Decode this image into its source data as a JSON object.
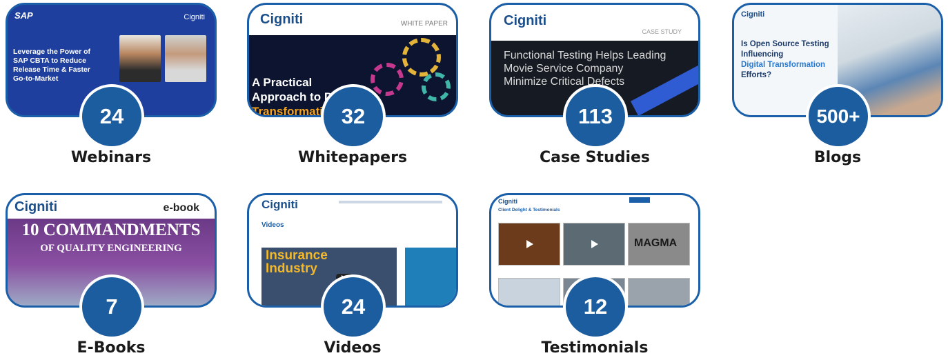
{
  "colors": {
    "accent": "#1c5d9f",
    "border": "#1b5fa8"
  },
  "cards": [
    {
      "key": "webinars",
      "count": "24",
      "label": "Webinars",
      "thumb": {
        "brand": "SAP",
        "logo": "Cigniti",
        "headline": [
          "Leverage the Power of",
          "SAP CBTA to Reduce",
          "Release Time & Faster",
          "Go-to-Market"
        ]
      }
    },
    {
      "key": "whitepapers",
      "count": "32",
      "label": "Whitepapers",
      "thumb": {
        "logo": "Cigniti",
        "tag": "WHITE PAPER",
        "headline": [
          "A Practical",
          "Approach to D",
          "Transformati"
        ]
      }
    },
    {
      "key": "case-studies",
      "count": "113",
      "label": "Case Studies",
      "thumb": {
        "logo": "Cigniti",
        "tag": "CASE STUDY",
        "headline": [
          "Functional Testing Helps Leading",
          "Movie Service Company",
          "Minimize Critical Defects"
        ]
      }
    },
    {
      "key": "blogs",
      "count": "500+",
      "label": "Blogs",
      "thumb": {
        "logo": "Cigniti",
        "headline": [
          "Is Open Source Testing",
          "Influencing",
          "Digital Transformation",
          "Efforts?"
        ]
      }
    },
    {
      "key": "ebooks",
      "count": "7",
      "label": "E-Books",
      "thumb": {
        "logo": "Cigniti",
        "tag": "e-book",
        "headline": [
          "10 COMMANDMENTS",
          "OF QUALITY ENGINEERING"
        ]
      }
    },
    {
      "key": "videos",
      "count": "24",
      "label": "Videos",
      "thumb": {
        "logo": "Cigniti",
        "heading": "Videos",
        "video_title": [
          "Insurance",
          "Industry"
        ]
      }
    },
    {
      "key": "testimonials",
      "count": "12",
      "label": "Testimonials",
      "thumb": {
        "logo": "Cigniti",
        "heading": "Client Delight & Testimonials",
        "tile_text": "MAGMA"
      }
    }
  ]
}
